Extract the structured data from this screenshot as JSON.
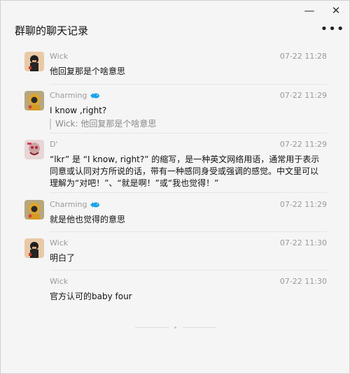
{
  "window": {
    "title": "群聊的聊天记录",
    "minimize_glyph": "—",
    "close_glyph": "✕",
    "more_glyph": "•••"
  },
  "messages": [
    {
      "sender": "Wick",
      "time": "07-22 11:28",
      "text": "他回复那是个啥意思",
      "avatar": "wick-avatar"
    },
    {
      "sender": "Charming",
      "time": "07-22 11:29",
      "text": "I know ,right?",
      "quote": "Wick: 他回复那是个啥意思",
      "avatar": "charming-avatar",
      "badge": "fish-badge-icon"
    },
    {
      "sender": "D'",
      "time": "07-22 11:29",
      "text": "“lkr” 是 “I know, right?” 的缩写，是一种英文网络用语，通常用于表示同意或认同对方所说的话，带有一种感同身受或强调的感觉。中文里可以理解为“对吧！”、“就是啊！”或“我也觉得！”",
      "avatar": "d-avatar"
    },
    {
      "sender": "Charming",
      "time": "07-22 11:29",
      "text": "就是他也觉得的意思",
      "avatar": "charming-avatar",
      "badge": "fish-badge-icon"
    },
    {
      "sender": "Wick",
      "time": "07-22 11:30",
      "text": "明白了",
      "avatar": "wick-avatar"
    },
    {
      "sender": "Wick",
      "time": "07-22 11:30",
      "text": "官方认可的baby four"
    }
  ],
  "colors": {
    "accent_badge": "#1aa3e8",
    "muted_text": "#9a9a9a",
    "bg": "#f5f5f5"
  }
}
